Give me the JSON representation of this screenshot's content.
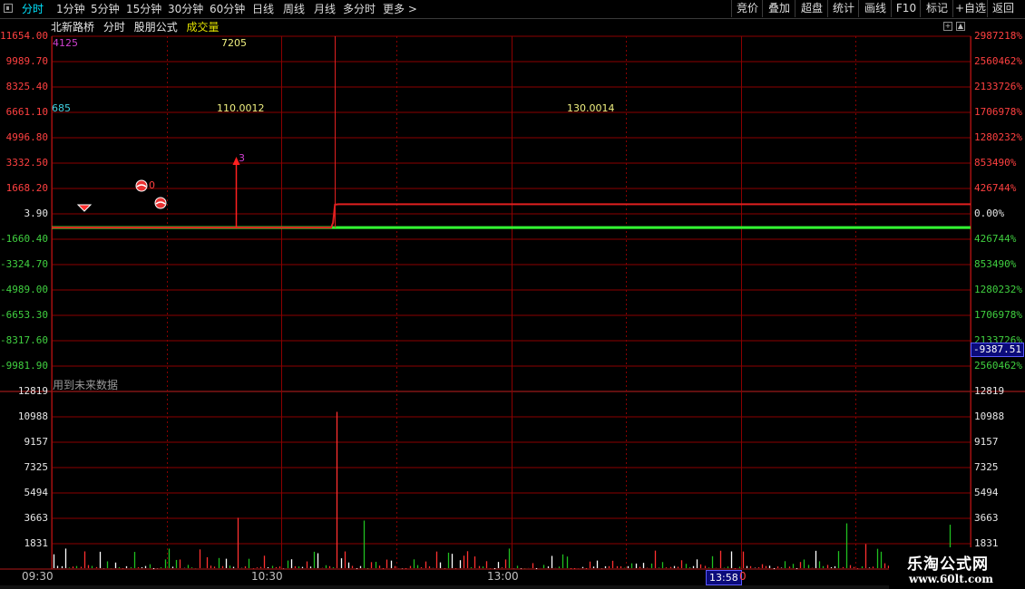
{
  "toolbar": {
    "periods": [
      "分时",
      "1分钟",
      "5分钟",
      "15分钟",
      "30分钟",
      "60分钟",
      "日线",
      "周线",
      "月线",
      "多分时",
      "更多 >"
    ],
    "active_index": 0,
    "right_buttons": [
      "竞价",
      "叠加",
      "超盘",
      "统计",
      "画线",
      "F10",
      "标记",
      "+自选",
      "返回"
    ]
  },
  "subheader": {
    "stock_name": "北新路桥",
    "mode": "分时",
    "formula": "股朋公式",
    "indicator": "成交量"
  },
  "price_axis": {
    "left_labels": [
      "11654.00",
      "9989.70",
      "8325.40",
      "6661.10",
      "4996.80",
      "3332.50",
      "1668.20",
      "3.90",
      "-1660.40",
      "-3324.70",
      "-4989.00",
      "-6653.30",
      "-8317.60",
      "-9981.90"
    ],
    "right_labels": [
      "2987218%",
      "2560462%",
      "2133726%",
      "1706978%",
      "1280232%",
      "853490%",
      "426744%",
      "0.00%",
      "426744%",
      "853490%",
      "1280232%",
      "1706978%",
      "2133726%",
      "2560462%"
    ],
    "current_value_tag": "-9387.51"
  },
  "annotations": {
    "top_left_value": "4125",
    "top_mid_value": "7205",
    "left_value": "685",
    "mid_value_1": "110.0012",
    "mid_value_2": "130.0014",
    "arrow_label": "3",
    "ball_label": "0"
  },
  "volume_axis": {
    "labels": [
      "12819",
      "10988",
      "9157",
      "7325",
      "5494",
      "3663",
      "1831"
    ],
    "note": "用到未来数据"
  },
  "time_axis": {
    "labels": [
      "09:30",
      "10:30",
      "13:00"
    ],
    "cursor_time": "13:58",
    "cursor_suffix": "0"
  },
  "watermark": {
    "title": "乐淘公式网",
    "url": "www.60lt.com"
  },
  "colors": {
    "grid": "#8b0000",
    "price_line": "#e02020",
    "baseline": "#33ff33",
    "vol_up": "#ff3030",
    "vol_down": "#20c020",
    "vol_flat": "#ffffff"
  },
  "chart_data": {
    "type": "line",
    "price": {
      "ylim": [
        -9981.9,
        11654.0
      ],
      "baseline": 3.9,
      "x_time": [
        "09:30",
        "10:30",
        "11:30/13:00",
        "14:00",
        "15:00"
      ],
      "series": [
        {
          "values_by_minute": [
            [
              0,
              3.9
            ],
            [
              73,
              3.9
            ],
            [
              73.5,
              300
            ],
            [
              74,
              1400
            ],
            [
              75,
              1420
            ],
            [
              240,
              1420
            ]
          ]
        }
      ]
    },
    "volume": {
      "ylim": [
        0,
        12819
      ],
      "notable_bars": [
        {
          "minute": 74,
          "value": 11350,
          "dir": "up"
        },
        {
          "minute": 48,
          "value": 3700,
          "dir": "up"
        },
        {
          "minute": 81,
          "value": 3500,
          "dir": "down"
        },
        {
          "minute": 207,
          "value": 3300,
          "dir": "down"
        },
        {
          "minute": 234,
          "value": 3200,
          "dir": "down"
        },
        {
          "minute": 212,
          "value": 1800,
          "dir": "up"
        }
      ]
    }
  }
}
